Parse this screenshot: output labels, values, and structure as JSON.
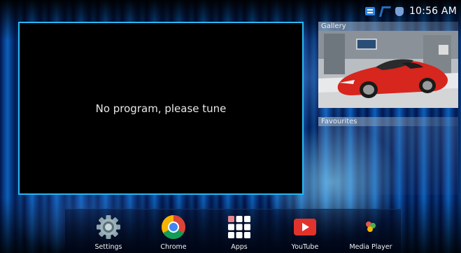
{
  "status_bar": {
    "time": "10:56 AM",
    "icons": [
      "usb-icon",
      "wifi-icon",
      "shield-icon"
    ]
  },
  "tv_window": {
    "message": "No program, please tune"
  },
  "side_panels": {
    "gallery_label": "Gallery",
    "favourites_label": "Favourites"
  },
  "dock": {
    "items": [
      {
        "label": "Settings",
        "icon": "settings-gear-icon"
      },
      {
        "label": "Chrome",
        "icon": "chrome-icon"
      },
      {
        "label": "Apps",
        "icon": "apps-grid-icon"
      },
      {
        "label": "YouTube",
        "icon": "youtube-icon"
      },
      {
        "label": "Media Player",
        "icon": "media-player-icon"
      }
    ]
  },
  "colors": {
    "accent": "#27b7f2",
    "background": "#02133f",
    "youtube_red": "#e1332b",
    "car_red": "#d6261d"
  }
}
